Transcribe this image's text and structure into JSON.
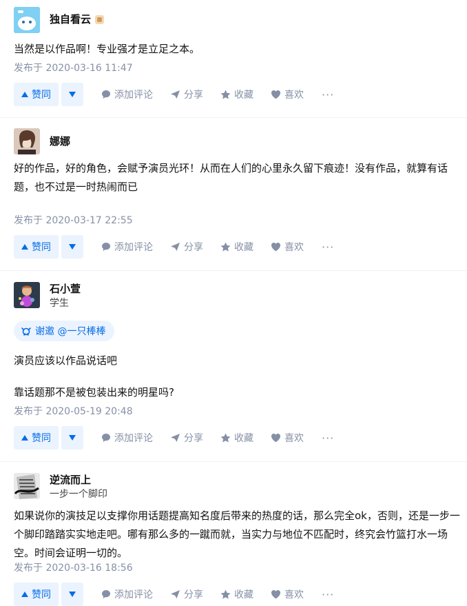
{
  "colors": {
    "accent": "#056de8",
    "muted": "#8590a6",
    "vote_bg": "#ebf3fe"
  },
  "action_labels": {
    "upvote": "赞同",
    "comment": "添加评论",
    "share": "分享",
    "collect": "收藏",
    "like": "喜欢",
    "more": "···"
  },
  "answers": [
    {
      "author": "独自看云",
      "headline": "",
      "content": [
        "当然是以作品啊！专业强才是立足之本。"
      ],
      "time": "发布于 2020-03-16 11:47"
    },
    {
      "author": "娜娜",
      "headline": "",
      "content": [
        "好的作品，好的角色，会赋予演员光环！从而在人们的心里永久留下痕迹！没有作品，就算有话题，也不过是一时热闹而已"
      ],
      "time": "发布于 2020-03-17 22:55"
    },
    {
      "author": "石小萱",
      "headline": "学生",
      "invite": "谢邀 @一只棒棒",
      "content": [
        "演员应该以作品说话吧",
        "靠话题那不是被包装出来的明星吗?"
      ],
      "time": "发布于 2020-05-19 20:48"
    },
    {
      "author": "逆流而上",
      "headline": "一步一个脚印",
      "content": [
        "如果说你的演技足以支撑你用话题提高知名度后带来的热度的话，那么完全ok，否则，还是一步一个脚印踏踏实实地走吧。哪有那么多的一蹴而就，当实力与地位不匹配时，终究会竹篮打水一场空。时间会证明一切的。"
      ],
      "time": "发布于 2020-03-16 18:56"
    }
  ]
}
